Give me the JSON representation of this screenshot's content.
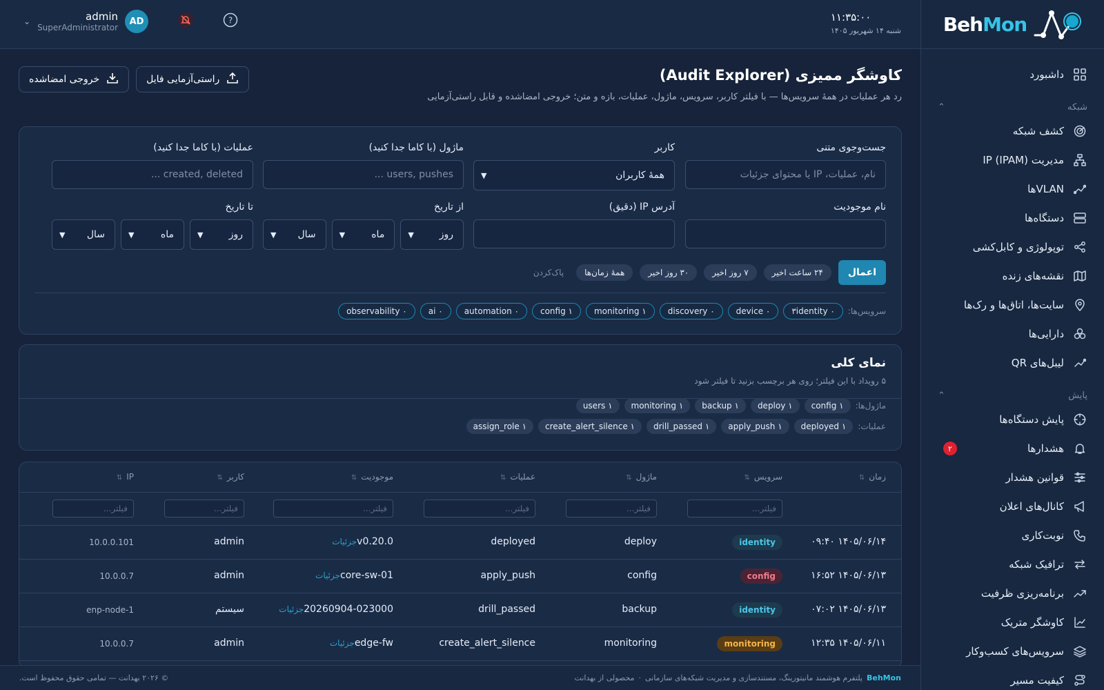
{
  "brand": {
    "part1": "Beh",
    "part2": "Mon"
  },
  "topbar": {
    "time": "۱۱:۳۵:۰۰",
    "date": "شنبه ۱۴ شهریور ۱۴۰۵",
    "user_name": "admin",
    "user_role": "SuperAdministrator",
    "avatar": "AD"
  },
  "sidebar": {
    "dashboard": "داشبورد",
    "section_network": "شبکه",
    "network_items": [
      {
        "label": "کشف شبکه",
        "icon": "radar-icon"
      },
      {
        "label": "مدیریت IP (IPAM)",
        "icon": "sitemap-icon"
      },
      {
        "label": "VLANها",
        "icon": "vlan-icon"
      },
      {
        "label": "دستگاه‌ها",
        "icon": "server-icon"
      },
      {
        "label": "توپولوژی و کابل‌کشی",
        "icon": "share-icon"
      },
      {
        "label": "نقشه‌های زنده",
        "icon": "map-icon"
      },
      {
        "label": "سایت‌ها، اتاق‌ها و رک‌ها",
        "icon": "location-pin-icon"
      },
      {
        "label": "دارایی‌ها",
        "icon": "boxes-icon"
      },
      {
        "label": "لیبل‌های QR",
        "icon": "qr-icon"
      }
    ],
    "section_monitoring": "پایش",
    "monitoring_items": [
      {
        "label": "پایش دستگاه‌ها",
        "icon": "crosshair-icon"
      },
      {
        "label": "هشدارها",
        "icon": "bell-icon",
        "badge": "۲"
      },
      {
        "label": "قوانین هشدار",
        "icon": "sliders-icon"
      },
      {
        "label": "کانال‌های اعلان",
        "icon": "megaphone-icon"
      },
      {
        "label": "نوبت‌کاری",
        "icon": "phone-icon"
      },
      {
        "label": "ترافیک شبکه",
        "icon": "arrows-icon"
      },
      {
        "label": "برنامه‌ریزی ظرفیت",
        "icon": "trend-icon"
      },
      {
        "label": "کاوشگر متریک",
        "icon": "chart-icon"
      },
      {
        "label": "سرویس‌های کسب‌وکار",
        "icon": "layers-icon"
      },
      {
        "label": "کیفیت مسیر",
        "icon": "route-icon"
      }
    ]
  },
  "page": {
    "title": "کاوشگر ممیزی (Audit Explorer)",
    "subtitle": "رد هر عملیات در همهٔ سرویس‌ها — با فیلتر کاربر، سرویس، ماژول، عملیات، بازه و متن؛ خروجی امضاشده و قابل راستی‌آزمایی",
    "btn_verify": "راستی‌آزمایی فایل",
    "btn_export": "خروجی امضاشده"
  },
  "filters": {
    "text_search_label": "جست‌وجوی متنی",
    "text_search_placeholder": "نام، عملیات، IP یا محتوای جزئیات",
    "user_label": "کاربر",
    "user_value": "همهٔ کاربران",
    "module_label": "ماژول (با کاما جدا کنید)",
    "module_placeholder": "users, pushes ...",
    "ops_label": "عملیات (با کاما جدا کنید)",
    "ops_placeholder": "created, deleted ...",
    "entity_label": "نام موجودیت",
    "ip_label": "آدرس IP (دقیق)",
    "from_label": "از تاریخ",
    "to_label": "تا تاریخ",
    "day": "روز",
    "month": "ماه",
    "year": "سال",
    "apply": "اعمال",
    "quick": [
      "۲۴ ساعت اخیر",
      "۷ روز اخیر",
      "۳۰ روز اخیر",
      "همهٔ زمان‌ها"
    ],
    "clear": "پاک‌کردن",
    "services_label": "سرویس‌ها:",
    "services": [
      "۳identity ۰",
      "device ۰",
      "discovery ۰",
      "monitoring ۱",
      "config ۱",
      "automation ۰",
      "ai ۰",
      "observability ۰"
    ]
  },
  "overview": {
    "title": "نمای کلی",
    "subtitle": "۵ رویداد با این فیلتر؛ روی هر برچسب بزنید تا فیلتر شود",
    "modules_label": "ماژول‌ها:",
    "modules": [
      "config ۱",
      "deploy ۱",
      "backup ۱",
      "monitoring ۱",
      "users ۱"
    ],
    "ops_label": "عملیات:",
    "ops": [
      "deployed ۱",
      "apply_push ۱",
      "drill_passed ۱",
      "create_alert_silence ۱",
      "assign_role ۱"
    ]
  },
  "table": {
    "headers": {
      "time": "زمان",
      "service": "سرویس",
      "module": "ماژول",
      "op": "عملیات",
      "entity": "موجودیت",
      "user": "کاربر",
      "ip": "IP"
    },
    "filter_placeholder": "فیلتر...",
    "detail_link": "جزئیات",
    "rows": [
      {
        "time": "۱۴۰۵/۰۶/۱۴ ۰۹:۴۰",
        "service": "identity",
        "module": "deploy",
        "op": "deployed",
        "entity": "v0.20.0",
        "user": "admin",
        "ip": "10.0.0.101"
      },
      {
        "time": "۱۴۰۵/۰۶/۱۳ ۱۶:۵۲",
        "service": "config",
        "module": "config",
        "op": "apply_push",
        "entity": "core-sw-01",
        "user": "admin",
        "ip": "10.0.0.7"
      },
      {
        "time": "۱۴۰۵/۰۶/۱۳ ۰۷:۰۲",
        "service": "identity",
        "module": "backup",
        "op": "drill_passed",
        "entity": "20260904-023000",
        "user": "سیستم",
        "ip": "enp-node-1"
      },
      {
        "time": "۱۴۰۵/۰۶/۱۱ ۱۲:۳۵",
        "service": "monitoring",
        "module": "monitoring",
        "op": "create_alert_silence",
        "entity": "edge-fw",
        "user": "admin",
        "ip": "10.0.0.7"
      }
    ]
  },
  "footer": {
    "brand": "BehMon",
    "desc": "پلتفرم هوشمند مانیتورینگ، مستندسازی و مدیریت شبکه‌های سازمانی",
    "sep": "·",
    "product": "محصولی از بهدانت",
    "copyright": "© ۲۰۲۶ بهدانت — تمامی حقوق محفوظ است."
  }
}
